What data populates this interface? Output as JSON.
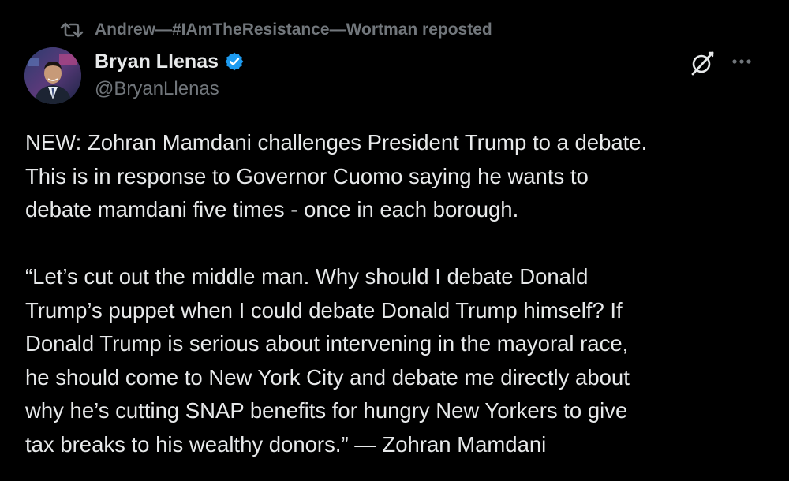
{
  "repost": {
    "icon": "repost-icon",
    "text": "Andrew—#IAmTheResistance—Wortman reposted"
  },
  "author": {
    "display_name": "Bryan Llenas",
    "handle": "@BryanLlenas",
    "verified": true,
    "verified_color": "#1d9bf0",
    "avatar": "avatar-photo"
  },
  "header_actions": {
    "grok_icon": "grok-icon",
    "more_icon": "more-icon"
  },
  "tweet": {
    "paragraph1_lines": [
      "NEW: Zohran Mamdani challenges President Trump to a debate.",
      "This is in response to Governor Cuomo saying he wants to",
      "debate mamdani five times - once in each borough."
    ],
    "paragraph2_lines": [
      "“Let’s cut out the middle man. Why should I debate Donald",
      "Trump’s puppet when I could debate Donald Trump himself? If",
      "Donald Trump is serious about intervening in the mayoral race,",
      "he should come to New York City and debate me directly about",
      "why he’s cutting SNAP benefits for hungry New Yorkers to give",
      "tax breaks to his wealthy donors.” — Zohran Mamdani"
    ]
  },
  "colors": {
    "background": "#000000",
    "primary_text": "#e7e9ea",
    "secondary_text": "#71767b",
    "accent": "#1d9bf0"
  }
}
